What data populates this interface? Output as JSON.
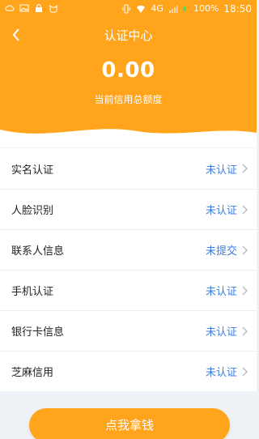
{
  "status_bar": {
    "network": "4G",
    "battery": "100%",
    "time": "18:50"
  },
  "header": {
    "title": "认证中心",
    "amount": "0.00",
    "amount_label": "当前信用总额度"
  },
  "items": [
    {
      "label": "实名认证",
      "status": "未认证"
    },
    {
      "label": "人脸识别",
      "status": "未认证"
    },
    {
      "label": "联系人信息",
      "status": "未提交"
    },
    {
      "label": "手机认证",
      "status": "未认证"
    },
    {
      "label": "银行卡信息",
      "status": "未认证"
    },
    {
      "label": "芝麻信用",
      "status": "未认证"
    }
  ],
  "cta_label": "点我拿钱",
  "colors": {
    "accent": "#ffa41b",
    "status_text": "#3b7de0",
    "background": "#eef1f5"
  }
}
